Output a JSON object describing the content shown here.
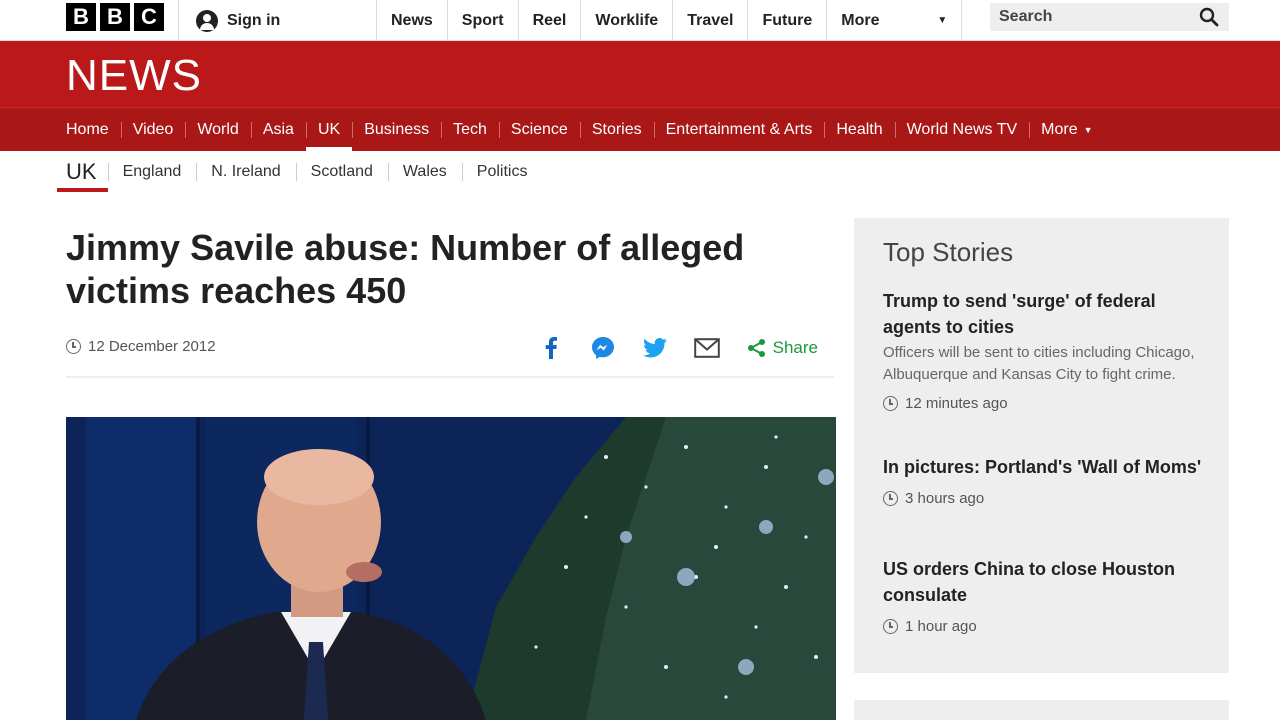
{
  "brand": {
    "logo_letters": [
      "B",
      "B",
      "C"
    ],
    "news_wordmark": "NEWS",
    "accent": "#bb1919",
    "nav_dark": "#a91717"
  },
  "topbar": {
    "signin_label": "Sign in",
    "nav": [
      "News",
      "Sport",
      "Reel",
      "Worklife",
      "Travel",
      "Future",
      "More"
    ],
    "search_placeholder": "Search"
  },
  "newsnav": {
    "items": [
      "Home",
      "Video",
      "World",
      "Asia",
      "UK",
      "Business",
      "Tech",
      "Science",
      "Stories",
      "Entertainment & Arts",
      "Health",
      "World News TV",
      "More"
    ],
    "active": "UK"
  },
  "secnav": {
    "current": "UK",
    "items": [
      "England",
      "N. Ireland",
      "Scotland",
      "Wales",
      "Politics"
    ]
  },
  "article": {
    "headline_line1": "Jimmy Savile abuse: Number of alleged",
    "headline_line2": "victims reaches 450",
    "date": "12 December 2012",
    "share_icons": [
      "facebook-icon",
      "messenger-icon",
      "twitter-icon",
      "email-icon"
    ],
    "share_label": "Share"
  },
  "top_stories": {
    "heading": "Top Stories",
    "stories": [
      {
        "title": "Trump to send 'surge' of federal agents to cities",
        "summary": "Officers will be sent to cities including Chicago, Albuquerque and Kansas City to fight crime.",
        "time": "12 minutes ago"
      },
      {
        "title": "In pictures: Portland's 'Wall of Moms'",
        "time": "3 hours ago"
      },
      {
        "title": "US orders China to close Houston consulate",
        "time": "1 hour ago"
      }
    ]
  }
}
